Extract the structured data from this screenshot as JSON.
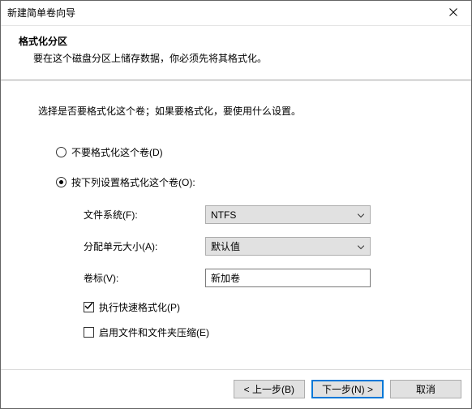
{
  "window": {
    "title": "新建简单卷向导"
  },
  "header": {
    "line1": "格式化分区",
    "line2": "要在这个磁盘分区上储存数据，你必须先将其格式化。"
  },
  "body": {
    "instruction": "选择是否要格式化这个卷；如果要格式化，要使用什么设置。",
    "radio_noformat": "不要格式化这个卷(D)",
    "radio_format": "按下列设置格式化这个卷(O):",
    "fs_label": "文件系统(F):",
    "fs_value": "NTFS",
    "alloc_label": "分配单元大小(A):",
    "alloc_value": "默认值",
    "vol_label": "卷标(V):",
    "vol_value": "新加卷",
    "check_quick": "执行快速格式化(P)",
    "check_compress": "启用文件和文件夹压缩(E)"
  },
  "footer": {
    "back": "< 上一步(B)",
    "next": "下一步(N) >",
    "cancel": "取消"
  }
}
